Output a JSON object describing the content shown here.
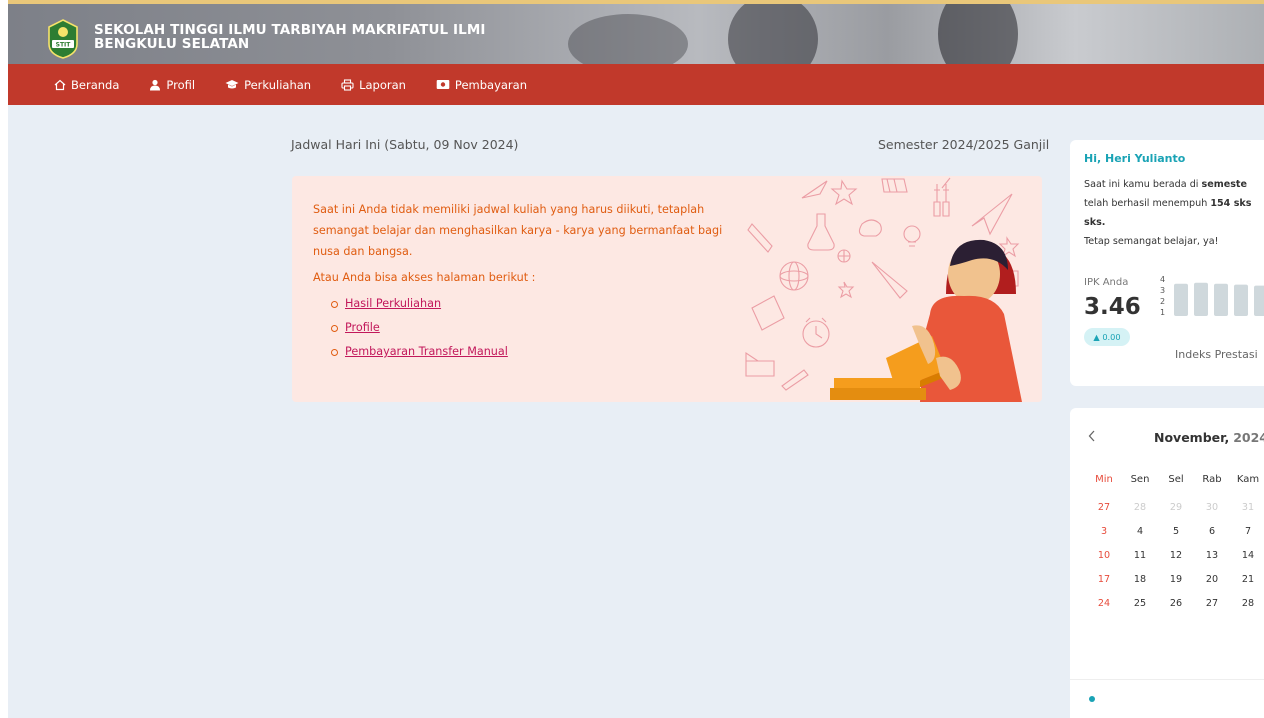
{
  "header": {
    "site_title": "SEKOLAH TINGGI ILMU TARBIYAH MAKRIFATUL ILMI BENGKULU SELATAN",
    "logo_text": "STIT"
  },
  "nav": {
    "items": [
      {
        "label": "Beranda",
        "icon": "home-icon"
      },
      {
        "label": "Profil",
        "icon": "user-icon"
      },
      {
        "label": "Perkuliahan",
        "icon": "graduation-cap-icon"
      },
      {
        "label": "Laporan",
        "icon": "printer-icon"
      },
      {
        "label": "Pembayaran",
        "icon": "money-icon"
      }
    ]
  },
  "main": {
    "schedule_title": "Jadwal Hari Ini (Sabtu, 09 Nov 2024)",
    "semester": "Semester 2024/2025 Ganjil",
    "notice": {
      "message": "Saat ini Anda tidak memiliki jadwal kuliah yang harus diikuti, tetaplah semangat belajar dan menghasilkan karya - karya yang bermanfaat bagi nusa dan bangsa.",
      "access_text": "Atau Anda bisa akses halaman berikut :",
      "links": [
        "Hasil Perkuliahan",
        "Profile",
        "Pembayaran Transfer Manual"
      ]
    }
  },
  "profile": {
    "greeting": "Hi, Heri Yulianto",
    "line1_prefix": "Saat ini kamu berada di ",
    "line1_bold": "semeste",
    "line2_prefix": "telah berhasil menempuh ",
    "line2_bold": "154 sks",
    "line3_bold": "sks.",
    "line4": "Tetap semangat belajar, ya!",
    "ipk_label": "IPK Anda",
    "ipk_value": "3.46",
    "delta": "▲ 0.00",
    "chart_title": "Indeks Prestasi",
    "chart_ticks": [
      "4",
      "3",
      "2",
      "1"
    ],
    "chart_bars": [
      3.4,
      3.5,
      3.4,
      3.3,
      3.2
    ]
  },
  "calendar": {
    "prev_icon": "chevron-left-icon",
    "month": "November,",
    "year": "2024",
    "days": [
      "Min",
      "Sen",
      "Sel",
      "Rab",
      "Kam"
    ],
    "weeks": [
      [
        "27",
        "28",
        "29",
        "30",
        "31"
      ],
      [
        "3",
        "4",
        "5",
        "6",
        "7"
      ],
      [
        "10",
        "11",
        "12",
        "13",
        "14"
      ],
      [
        "17",
        "18",
        "19",
        "20",
        "21"
      ],
      [
        "24",
        "25",
        "26",
        "27",
        "28"
      ]
    ],
    "muted_first_row": true
  },
  "colors": {
    "navbar": "#c1392b",
    "accent": "#1aa3b5",
    "notice_bg": "#fde8e3",
    "notice_text": "#e05d12",
    "link": "#c2185b"
  }
}
